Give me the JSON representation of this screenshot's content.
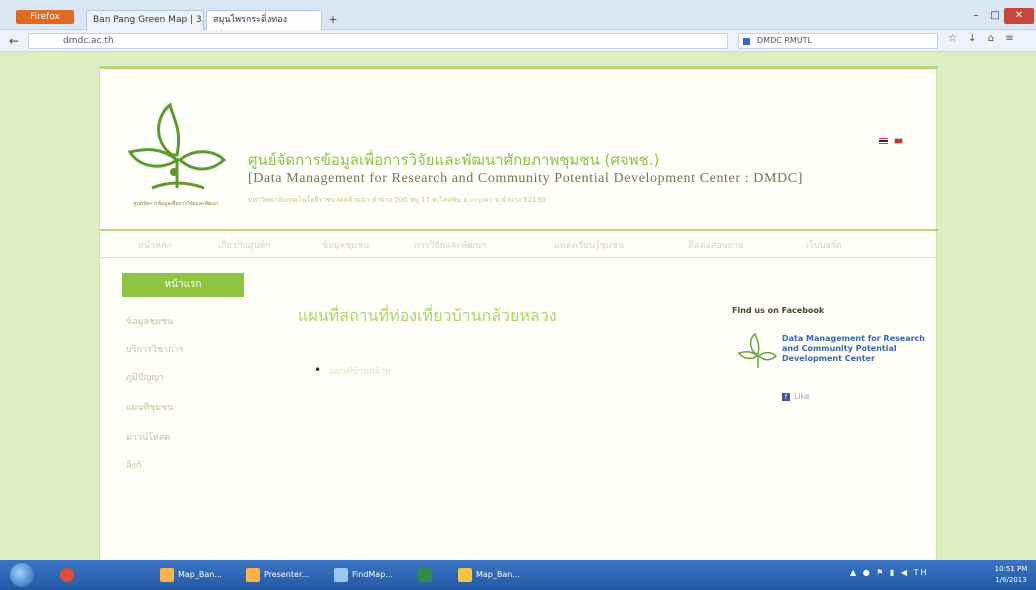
{
  "browser": {
    "firefox_label": "Firefox",
    "tabs": [
      {
        "label": "Ban Pang Green Map | 3..."
      },
      {
        "label": "สมุนไพรกระดิ่งทอง"
      }
    ],
    "new_tab_label": "+",
    "url": "dmdc.ac.th",
    "search_placeholder": "DMDC RMUTL",
    "nav_tools": "☆ ↓ ⌂ ≡",
    "win_min": "–",
    "win_max": "□",
    "win_close": "✕"
  },
  "site": {
    "title_th": "ศูนย์จัดการข้อมูลเพื่อการวิจัยและพัฒนาศักยภาพชุมชน (ศจพช.)",
    "title_en": "[Data Management for Research and Community Potential Development Center : DMDC]",
    "subtitle": "มหาวิทยาลัยเทคโนโลยีราชมงคลล้านนา ลำปาง 200 หมู่ 17 ต.ไหล่หิน อ.เกาะคา จ.ลำปาง 52130",
    "logo_caption": "ศูนย์จัดการข้อมูลเพื่อการวิจัยและพัฒนา",
    "lang_flags": [
      "th-flag",
      "en-flag"
    ]
  },
  "menu": {
    "items": [
      "หน้าหลัก",
      "เกี่ยวกับศูนย์ฯ",
      "ข้อมูลชุมชน",
      "การวิจัยและพัฒนา",
      "แหล่งเรียนรู้ชุมชน",
      "ติดต่อสอบถาม",
      "เว็บบอร์ด"
    ]
  },
  "sidebar": {
    "active": "หน้าแรก",
    "items": [
      "ข้อมูลชุมชน",
      "บริการวิชาการ",
      "ภูมิปัญญา",
      "แผนที่ชุมชน",
      "ดาวน์โหลด",
      "ลิงก์"
    ]
  },
  "content": {
    "page_title": "แผนที่สถานที่ท่องเที่ยวบ้านกล้วยหลวง",
    "bullet": "แผนที่บ้านกล้วย"
  },
  "facebook": {
    "heading": "Find us on Facebook",
    "page_name": "Data Management for Research and Community Potential Development Center",
    "like_label": "Like"
  },
  "taskbar": {
    "buttons": [
      "Map_Ban...",
      "Presenter...",
      "FindMap...",
      "",
      "Map_Ban..."
    ],
    "tray_text": "TH",
    "clock_time": "10:51 PM",
    "clock_date": "1/6/2013"
  },
  "colors": {
    "brand_green": "#8ec63f",
    "page_background": "#ddefc2",
    "facebook_blue": "#3b66b3"
  }
}
